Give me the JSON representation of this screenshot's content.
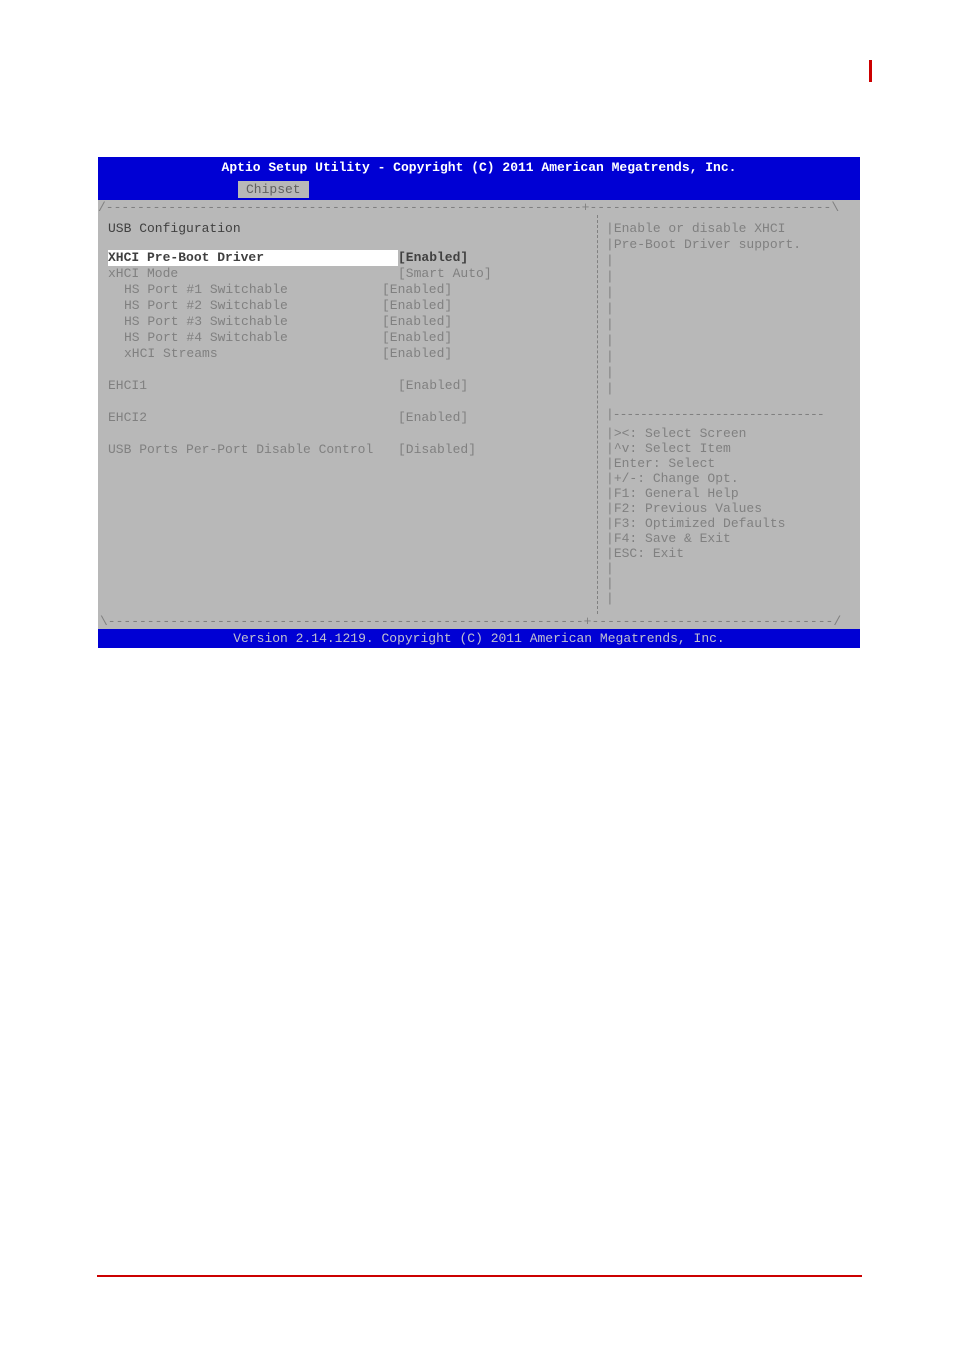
{
  "header": {
    "title": "Aptio Setup Utility - Copyright (C) 2011 American Megatrends, Inc.",
    "tab": "Chipset"
  },
  "section": {
    "title": "USB Configuration"
  },
  "items": [
    {
      "label": "XHCI Pre-Boot Driver",
      "value": "[Enabled]",
      "selected": true,
      "indent": false
    },
    {
      "label": "xHCI Mode",
      "value": "[Smart Auto]",
      "selected": false,
      "indent": false
    },
    {
      "label": "HS Port #1 Switchable",
      "value": "[Enabled]",
      "selected": false,
      "indent": true
    },
    {
      "label": "HS Port #2 Switchable",
      "value": "[Enabled]",
      "selected": false,
      "indent": true
    },
    {
      "label": "HS Port #3 Switchable",
      "value": "[Enabled]",
      "selected": false,
      "indent": true
    },
    {
      "label": "HS Port #4 Switchable",
      "value": "[Enabled]",
      "selected": false,
      "indent": true
    },
    {
      "label": "xHCI Streams",
      "value": "[Enabled]",
      "selected": false,
      "indent": true
    }
  ],
  "ehci1": {
    "label": "EHCI1",
    "value": "[Enabled]"
  },
  "ehci2": {
    "label": "EHCI2",
    "value": "[Enabled]"
  },
  "usbPorts": {
    "label": "USB Ports Per-Port Disable Control",
    "value": "[Disabled]"
  },
  "help": {
    "line1": "Enable or disable XHCI",
    "line2": "Pre-Boot Driver support."
  },
  "nav": {
    "l1": "><: Select Screen",
    "l2": "^v: Select Item",
    "l3": "Enter: Select",
    "l4": "+/-: Change Opt.",
    "l5": "F1: General Help",
    "l6": "F2: Previous Values",
    "l7": "F3: Optimized Defaults",
    "l8": "F4: Save & Exit",
    "l9": "ESC: Exit"
  },
  "footer": {
    "version": "Version 2.14.1219. Copyright (C) 2011 American Megatrends, Inc."
  }
}
